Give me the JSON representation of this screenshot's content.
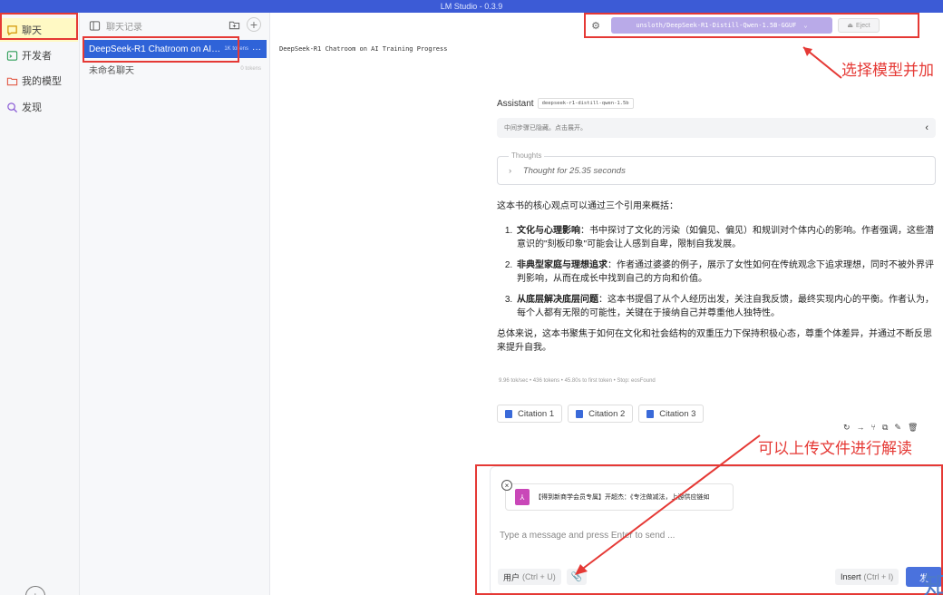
{
  "titlebar": {
    "title": "LM Studio - 0.3.9"
  },
  "nav": {
    "items": [
      {
        "label": "聊天",
        "icon": "chat-bubble-icon"
      },
      {
        "label": "开发者",
        "icon": "terminal-icon"
      },
      {
        "label": "我的模型",
        "icon": "folder-icon"
      },
      {
        "label": "发现",
        "icon": "search-icon"
      }
    ],
    "bottom_icon": "download-icon"
  },
  "chatlist": {
    "header": "聊天记录",
    "chats": [
      {
        "title": "DeepSeek-R1 Chatroom on AI Trai...",
        "tokens": "1K tokens",
        "more": "···"
      },
      {
        "title": "未命名聊天",
        "tokens": "0 tokens"
      }
    ]
  },
  "main": {
    "title": "DeepSeek-R1 Chatroom on AI Training Progress",
    "model": "unsloth/DeepSeek-R1-Distill-Qwen-1.5B-GGUF",
    "eject": "Eject"
  },
  "message": {
    "role": "Assistant",
    "model_tag": "deepseek-r1-distill-qwen-1.5b",
    "hidden_steps": "中间步骤已隐藏。点击展开。",
    "thoughts_label": "Thoughts",
    "thoughts_summary": "Thought for 25.35 seconds",
    "intro": "这本书的核心观点可以通过三个引用来概括：",
    "points": [
      {
        "head": "文化与心理影响",
        "body": "：书中探讨了文化的污染（如偏见、偏见）和规训对个体内心的影响。作者强调，这些潜意识的\"刻板印象\"可能会让人感到自卑，限制自我发展。"
      },
      {
        "head": "非典型家庭与理想追求",
        "body": "：作者通过婆婆的例子，展示了女性如何在传统观念下追求理想，同时不被外界评判影响，从而在成长中找到自己的方向和价值。"
      },
      {
        "head": "从底层解决底层问题",
        "body": "：这本书提倡了从个人经历出发，关注自我反馈，最终实现内心的平衡。作者认为，每个人都有无限的可能性，关键在于接纳自己并尊重他人独特性。"
      }
    ],
    "conclusion": "总体来说，这本书聚焦于如何在文化和社会结构的双重压力下保持积极心态，尊重个体差异，并通过不断反思来提升自我。",
    "stats": "9.96 tok/sec • 436 tokens • 45.80s to first token • Stop: eosFound",
    "citations": [
      "Citation 1",
      "Citation 2",
      "Citation 3"
    ],
    "actions": [
      "↻",
      "→",
      "⑂",
      "⧉",
      "✎",
      "🗑"
    ]
  },
  "annotations": {
    "select_model": "选择模型并加",
    "upload": "可以上传文件进行解读",
    "corner": "知"
  },
  "composer": {
    "file_name": "【得到新商学会员专属】开超杰：《专注做减法，上游供应链如",
    "placeholder": "Type a message and press Enter to send ...",
    "role_label": "用户",
    "role_shortcut": "(Ctrl + U)",
    "insert_label": "Insert",
    "insert_shortcut": "(Ctrl + I)",
    "send_label": "发"
  },
  "colors": {
    "accent": "#2f63d8",
    "annotation": "#e53935",
    "model_pill": "#b9aae8"
  }
}
